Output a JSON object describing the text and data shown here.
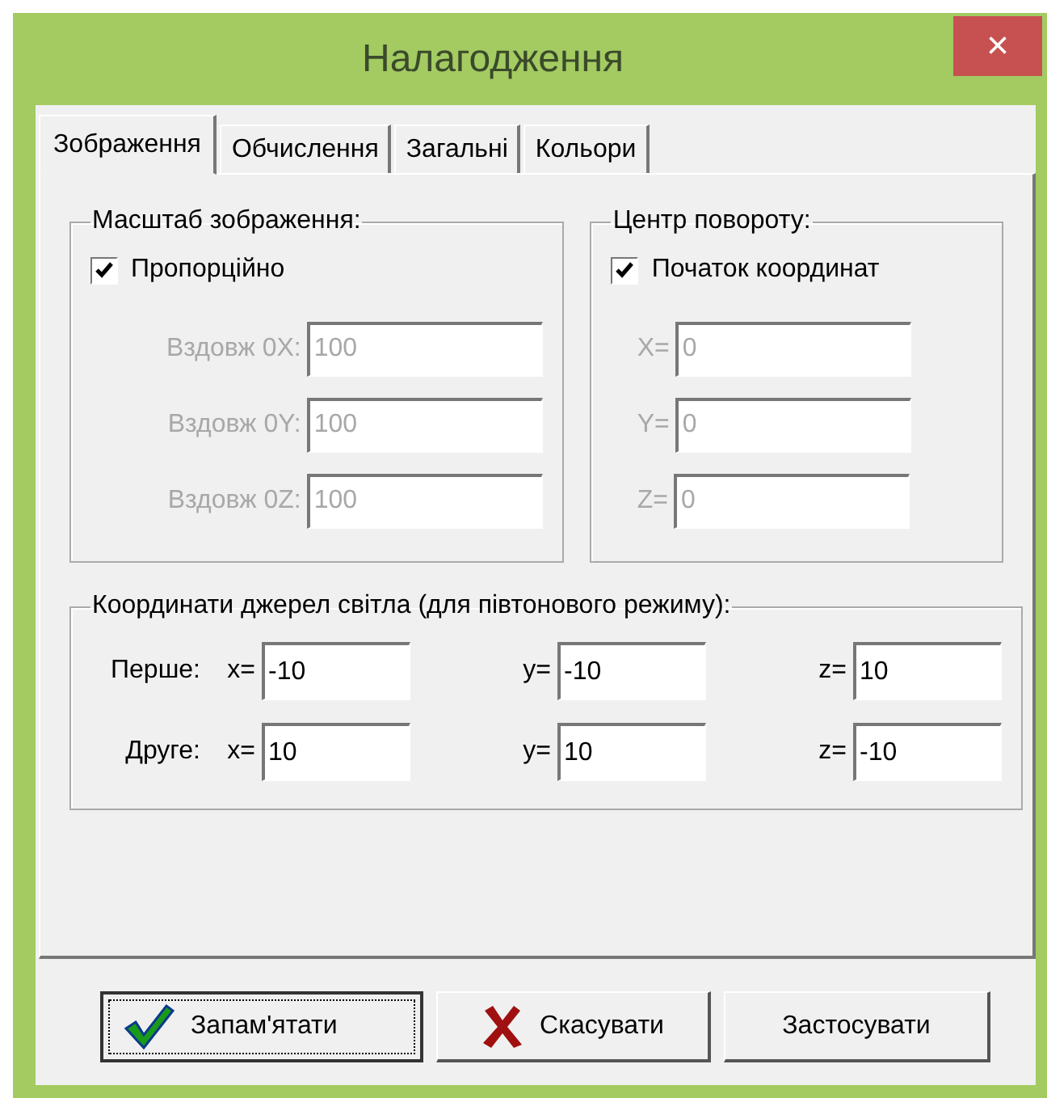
{
  "window": {
    "title": "Налагодження",
    "close": "×"
  },
  "tabs": [
    {
      "label": "Зображення",
      "selected": true
    },
    {
      "label": "Обчислення",
      "selected": false
    },
    {
      "label": "Загальні",
      "selected": false
    },
    {
      "label": "Кольори",
      "selected": false
    }
  ],
  "scale_group": {
    "title": "Масштаб зображення:",
    "checkbox": {
      "label": "Пропорційно",
      "checked": true
    },
    "fields": [
      {
        "label": "Вздовж 0X:",
        "value": "100",
        "disabled": true
      },
      {
        "label": "Вздовж 0Y:",
        "value": "100",
        "disabled": true
      },
      {
        "label": "Вздовж 0Z:",
        "value": "100",
        "disabled": true
      }
    ]
  },
  "rotation_group": {
    "title": "Центр повороту:",
    "checkbox": {
      "label": "Початок координат",
      "checked": true
    },
    "fields": [
      {
        "label": "X=",
        "value": "0",
        "disabled": true
      },
      {
        "label": "Y=",
        "value": "0",
        "disabled": true
      },
      {
        "label": "Z=",
        "value": "0",
        "disabled": true
      }
    ]
  },
  "light_group": {
    "title": "Координати джерел світла (для півтонового режиму):",
    "rows": [
      {
        "label": "Перше:",
        "fields": [
          {
            "label": "x=",
            "value": "-10"
          },
          {
            "label": "y=",
            "value": "-10"
          },
          {
            "label": "z=",
            "value": "10"
          }
        ]
      },
      {
        "label": "Друге:",
        "fields": [
          {
            "label": "x=",
            "value": "10"
          },
          {
            "label": "y=",
            "value": "10"
          },
          {
            "label": "z=",
            "value": "-10"
          }
        ]
      }
    ]
  },
  "buttons": [
    {
      "label": "Запам'ятати",
      "kind": "ok",
      "focused": true
    },
    {
      "label": "Скасувати",
      "kind": "cancel",
      "focused": false
    },
    {
      "label": "Застосувати",
      "kind": "plain",
      "focused": false
    }
  ]
}
